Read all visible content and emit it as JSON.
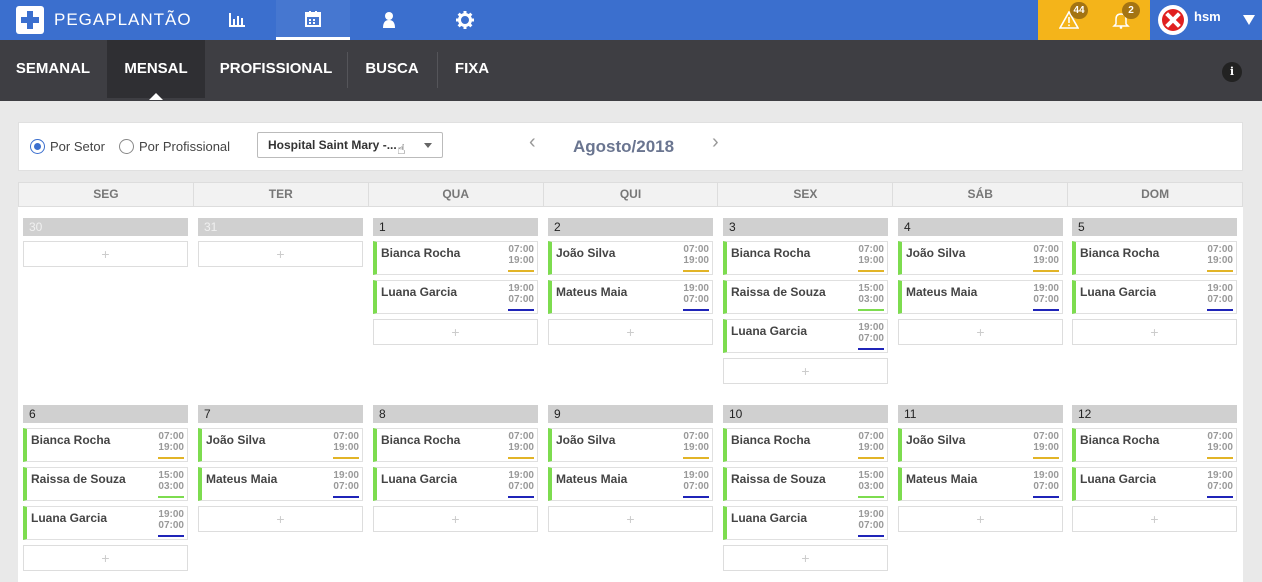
{
  "brand": {
    "name": "PEGAPLANTÃO"
  },
  "topnav": {
    "icons": [
      {
        "name": "chart-icon"
      },
      {
        "name": "calendar-icon"
      },
      {
        "name": "user-icon"
      },
      {
        "name": "gear-icon"
      }
    ],
    "active_icon": "calendar-icon"
  },
  "alerts": {
    "warning_count": "44",
    "notification_count": "2"
  },
  "user": {
    "name": "hsm"
  },
  "tabs": [
    {
      "label": "SEMANAL"
    },
    {
      "label": "MENSAL"
    },
    {
      "label": "PROFISSIONAL"
    },
    {
      "label": "BUSCA"
    },
    {
      "label": "FIXA"
    }
  ],
  "active_tab": "MENSAL",
  "filter": {
    "radio_sector": "Por Setor",
    "radio_professional": "Por Profissional",
    "selected_radio": "Por Setor",
    "hospital": "Hospital Saint Mary -...",
    "month": "Agosto/2018",
    "prev": "‹",
    "next": "›"
  },
  "weekdays": [
    "SEG",
    "TER",
    "QUA",
    "QUI",
    "SEX",
    "SÁB",
    "DOM"
  ],
  "colors": {
    "day_shift": "#e2b427",
    "night_shift": "#1f24b8",
    "afternoon_shift": "#7ddc4f",
    "shift_border": "#7ddc4f",
    "brand": "#3b6fce",
    "alert": "#f4b41a"
  },
  "add_label": "+",
  "calendar": {
    "weeks": [
      [
        {
          "day": "30",
          "muted": true,
          "shifts": []
        },
        {
          "day": "31",
          "muted": true,
          "shifts": []
        },
        {
          "day": "1",
          "shifts": [
            {
              "name": "Bianca Rocha",
              "start": "07:00",
              "end": "19:00",
              "type": "day"
            },
            {
              "name": "Luana Garcia",
              "start": "19:00",
              "end": "07:00",
              "type": "night"
            }
          ]
        },
        {
          "day": "2",
          "shifts": [
            {
              "name": "João Silva",
              "start": "07:00",
              "end": "19:00",
              "type": "day"
            },
            {
              "name": "Mateus Maia",
              "start": "19:00",
              "end": "07:00",
              "type": "night"
            }
          ]
        },
        {
          "day": "3",
          "shifts": [
            {
              "name": "Bianca Rocha",
              "start": "07:00",
              "end": "19:00",
              "type": "day"
            },
            {
              "name": "Raissa de Souza",
              "start": "15:00",
              "end": "03:00",
              "type": "afternoon"
            },
            {
              "name": "Luana Garcia",
              "start": "19:00",
              "end": "07:00",
              "type": "night"
            }
          ]
        },
        {
          "day": "4",
          "shifts": [
            {
              "name": "João Silva",
              "start": "07:00",
              "end": "19:00",
              "type": "day"
            },
            {
              "name": "Mateus Maia",
              "start": "19:00",
              "end": "07:00",
              "type": "night"
            }
          ]
        },
        {
          "day": "5",
          "shifts": [
            {
              "name": "Bianca Rocha",
              "start": "07:00",
              "end": "19:00",
              "type": "day"
            },
            {
              "name": "Luana Garcia",
              "start": "19:00",
              "end": "07:00",
              "type": "night"
            }
          ]
        }
      ],
      [
        {
          "day": "6",
          "shifts": [
            {
              "name": "Bianca Rocha",
              "start": "07:00",
              "end": "19:00",
              "type": "day"
            },
            {
              "name": "Raissa de Souza",
              "start": "15:00",
              "end": "03:00",
              "type": "afternoon"
            },
            {
              "name": "Luana Garcia",
              "start": "19:00",
              "end": "07:00",
              "type": "night"
            }
          ]
        },
        {
          "day": "7",
          "shifts": [
            {
              "name": "João Silva",
              "start": "07:00",
              "end": "19:00",
              "type": "day"
            },
            {
              "name": "Mateus Maia",
              "start": "19:00",
              "end": "07:00",
              "type": "night"
            }
          ]
        },
        {
          "day": "8",
          "shifts": [
            {
              "name": "Bianca Rocha",
              "start": "07:00",
              "end": "19:00",
              "type": "day"
            },
            {
              "name": "Luana Garcia",
              "start": "19:00",
              "end": "07:00",
              "type": "night"
            }
          ]
        },
        {
          "day": "9",
          "shifts": [
            {
              "name": "João Silva",
              "start": "07:00",
              "end": "19:00",
              "type": "day"
            },
            {
              "name": "Mateus Maia",
              "start": "19:00",
              "end": "07:00",
              "type": "night"
            }
          ]
        },
        {
          "day": "10",
          "shifts": [
            {
              "name": "Bianca Rocha",
              "start": "07:00",
              "end": "19:00",
              "type": "day"
            },
            {
              "name": "Raissa de Souza",
              "start": "15:00",
              "end": "03:00",
              "type": "afternoon"
            },
            {
              "name": "Luana Garcia",
              "start": "19:00",
              "end": "07:00",
              "type": "night"
            }
          ]
        },
        {
          "day": "11",
          "shifts": [
            {
              "name": "João Silva",
              "start": "07:00",
              "end": "19:00",
              "type": "day"
            },
            {
              "name": "Mateus Maia",
              "start": "19:00",
              "end": "07:00",
              "type": "night"
            }
          ]
        },
        {
          "day": "12",
          "shifts": [
            {
              "name": "Bianca Rocha",
              "start": "07:00",
              "end": "19:00",
              "type": "day"
            },
            {
              "name": "Luana Garcia",
              "start": "19:00",
              "end": "07:00",
              "type": "night"
            }
          ]
        }
      ]
    ]
  }
}
